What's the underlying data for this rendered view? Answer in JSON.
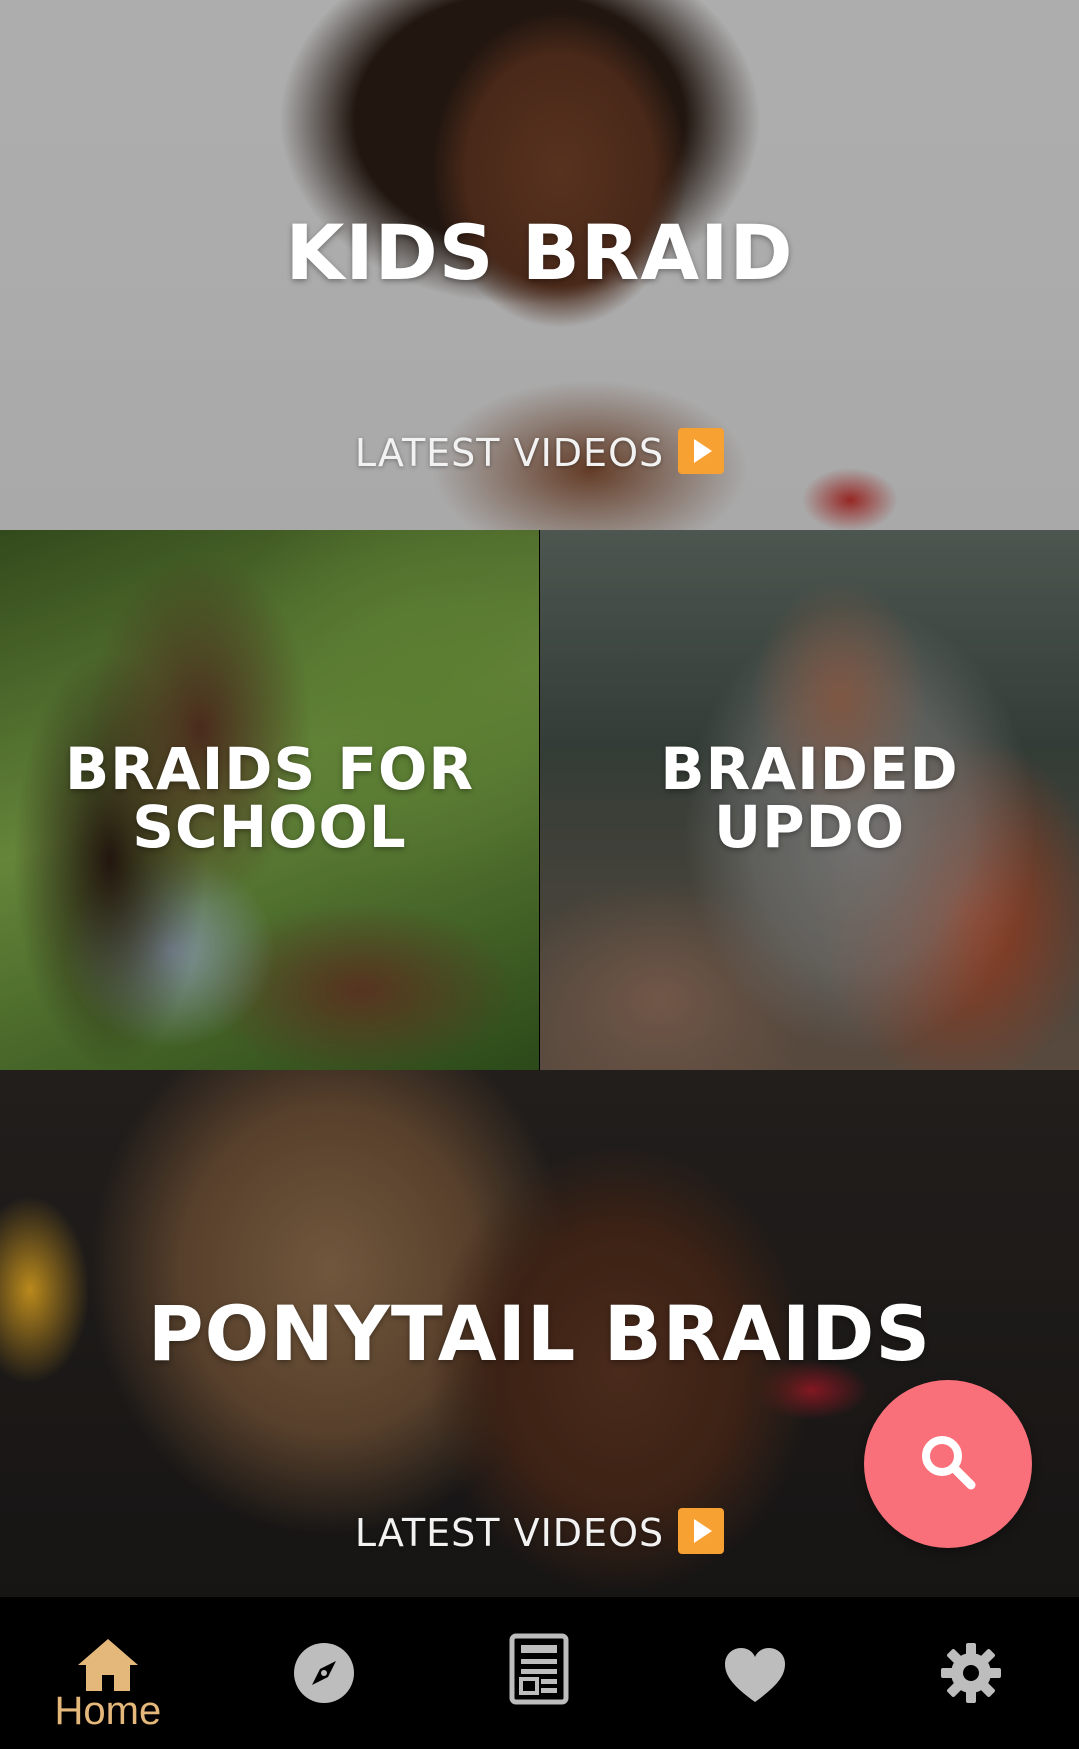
{
  "tiles": {
    "kids": {
      "title": "KIDS BRAID",
      "latest_label": "LATEST VIDEOS"
    },
    "school": {
      "title_line1": "BRAIDS FOR",
      "title_line2": "SCHOOL"
    },
    "updo": {
      "title_line1": "BRAIDED",
      "title_line2": "UPDO"
    },
    "ponytail": {
      "title": "PONYTAIL BRAIDS",
      "latest_label": "LATEST VIDEOS"
    }
  },
  "fab": {
    "icon": "search-icon",
    "color": "#f9707a"
  },
  "bottom_nav": {
    "items": [
      {
        "icon": "home-icon",
        "label": "Home",
        "active": true
      },
      {
        "icon": "compass-icon",
        "label": "",
        "active": false
      },
      {
        "icon": "newspaper-icon",
        "label": "",
        "active": false
      },
      {
        "icon": "heart-icon",
        "label": "",
        "active": false
      },
      {
        "icon": "gear-icon",
        "label": "",
        "active": false
      }
    ],
    "active_color": "#e4b77a",
    "inactive_color": "#bdbdbd"
  }
}
